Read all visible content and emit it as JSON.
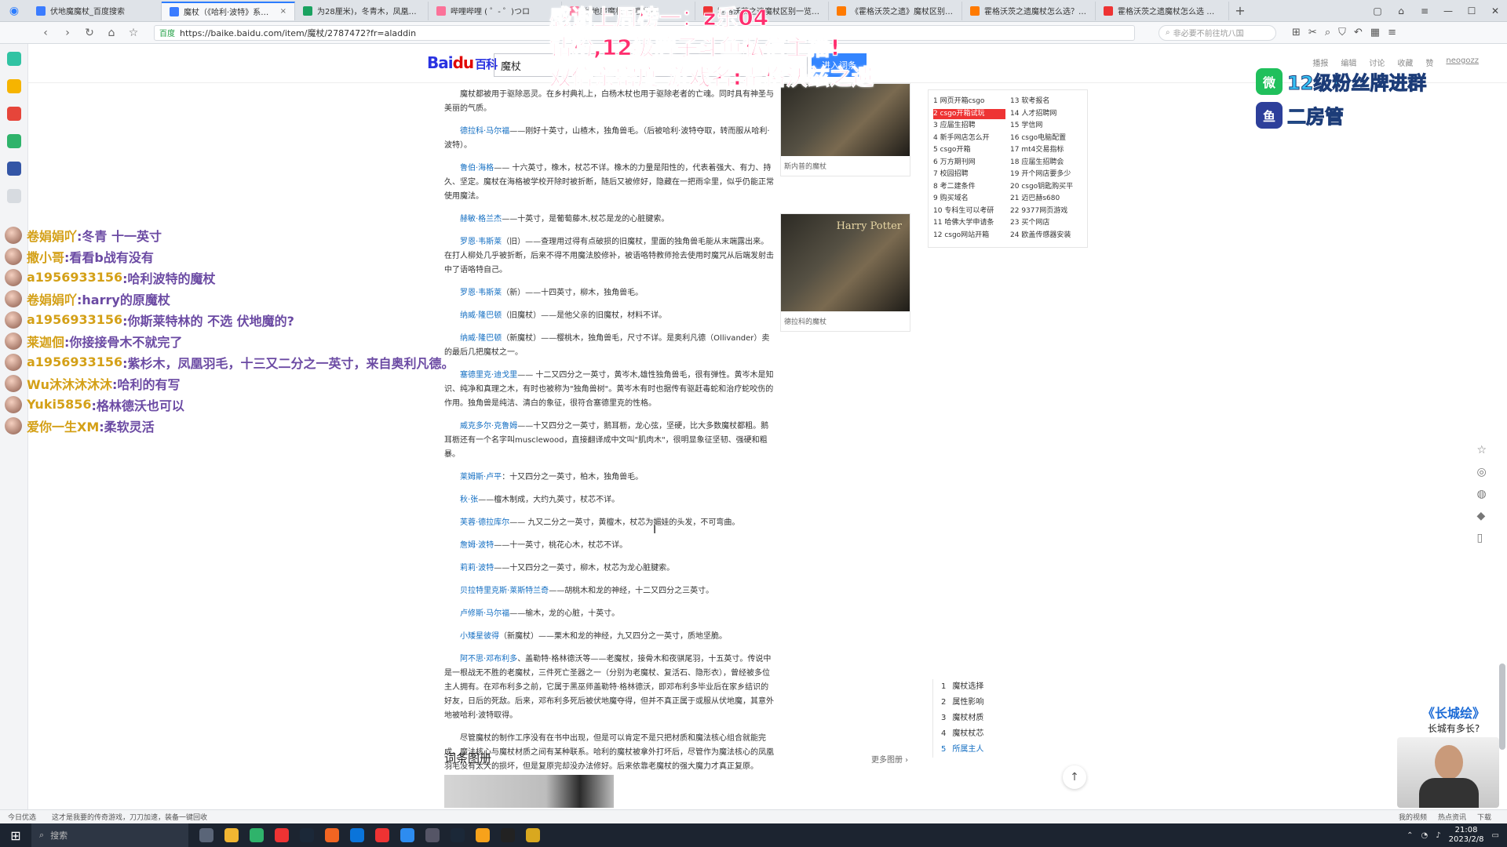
{
  "tabs": [
    {
      "label": "伏地魔魔杖_百度搜索",
      "color": "#3b7cff",
      "active": false
    },
    {
      "label": "魔杖（《哈利·波特》系列中的魔法）",
      "color": "#3b7cff",
      "active": true
    },
    {
      "label": "为28厘米)，冬青木，凤凰羽毛",
      "color": "#1aa260",
      "active": false
    },
    {
      "label": "哔哩哔哩 ( ゜- ゜)つロ",
      "color": "#fb7299",
      "active": false
    },
    {
      "label": "伏地魔魔杖-哔哩哔哩",
      "color": "#fb7299",
      "active": false
    },
    {
      "label": "霍格沃茨之遗魔杖区别一览-JD",
      "color": "#e33",
      "active": false
    },
    {
      "label": "《霍格沃茨之遗》魔杖区别介绍",
      "color": "#ff7a00",
      "active": false
    },
    {
      "label": "霍格沃茨之遗魔杖怎么选？魔杖",
      "color": "#ff7a00",
      "active": false
    },
    {
      "label": "霍格沃茨之遗魔杖怎么选 魔杖",
      "color": "#e33",
      "active": false
    }
  ],
  "address": {
    "secure_label": "百度",
    "url": "https://baike.baidu.com/item/魔杖/2787472?fr=aladdin",
    "side_search_placeholder": "非必要不前往坑八国"
  },
  "header": {
    "logo_bai": "Bai",
    "logo_du": "du",
    "logo_baike": "百科",
    "search_value": "魔杖",
    "enter_button": "进入词条",
    "actions": [
      "播报",
      "编辑",
      "讨论",
      "收藏",
      "赞"
    ],
    "user": "neogozz"
  },
  "overlay_top": {
    "line1": "感谢上周榜一：z乐04",
    "line2": "钻粉,12级牌子斗鱼私信主播!",
    "line3": "双倍亲密度 游戏名:霍格沃兹之遗"
  },
  "wechat_promo": {
    "row1": "12级粉丝牌进群",
    "row2": "二房管",
    "badge1": "微",
    "badge2": "鱼"
  },
  "paragraphs": [
    {
      "name": "",
      "text": "魔杖都被用于驱除恶灵。在乡村典礼上，白杨木杖也用于驱除老者的亡魂。同时具有神圣与美丽的气质。"
    },
    {
      "name": "德拉科·马尔福",
      "text": "——刚好十英寸，山楂木，独角兽毛。（后被哈利·波特夺取，转而服从哈利·波特）。"
    },
    {
      "name": "鲁伯·海格",
      "text": "—— 十六英寸，橡木，杖芯不详。橡木的力量是阳性的，代表着强大、有力、持久、坚定。魔杖在海格被学校开除时被折断，随后又被修好，隐藏在一把雨伞里，似乎仍能正常使用魔法。"
    },
    {
      "name": "赫敏·格兰杰",
      "text": "——十英寸，是葡萄藤木,杖芯是龙的心脏腱索。"
    },
    {
      "name": "罗恩·韦斯莱",
      "text": "（旧）——查理用过得有点破损的旧魔杖，里面的独角兽毛能从末端露出来。在打人柳处几乎被折断，后来不得不用魔法胶修补，被语咯特教师抢去使用时魔咒从后端发射击中了语咯特自己。"
    },
    {
      "name": "罗恩·韦斯莱",
      "text": "（新）——十四英寸，柳木，独角兽毛。"
    },
    {
      "name": "纳威·隆巴顿",
      "text": "（旧魔杖）——是他父亲的旧魔杖，材料不详。"
    },
    {
      "name": "纳威·隆巴顿",
      "text": "（新魔杖）——樱桃木，独角兽毛，尺寸不详。是奥利凡德（Ollivander）卖的最后几把魔杖之一。"
    },
    {
      "name": "塞德里克·迪戈里",
      "text": "—— 十二又四分之一英寸，黄岑木,雄性独角兽毛，很有弹性。黄岑木是知识、纯净和真理之木，有时也被称为\"独角兽树\"。黄岑木有时也据传有驱赶毒蛇和治疗蛇咬伤的作用。独角兽是纯洁、清白的象征，很符合塞德里克的性格。"
    },
    {
      "name": "威克多尔·克鲁姆",
      "text": "——十又四分之一英寸，鹅耳枥，龙心弦，坚硬，比大多数魔杖都粗。鹅耳枥还有一个名字叫musclewood，直接翻译成中文叫\"肌肉木\"，很明显象征坚韧、强硬和粗暴。"
    },
    {
      "name": "莱姆斯·卢平",
      "text": "：十又四分之一英寸，柏木，独角兽毛。"
    },
    {
      "name": "秋·张",
      "text": "——檀木制成，大约九英寸，杖芯不详。"
    },
    {
      "name": "芙蓉·德拉库尔",
      "text": "—— 九又二分之一英寸，黄檀木，杖芯为媚娃的头发，不可弯曲。"
    },
    {
      "name": "詹姆·波特",
      "text": "——十一英寸，桃花心木，杖芯不详。"
    },
    {
      "name": "莉莉·波特",
      "text": "——十又四分之一英寸，柳木，杖芯为龙心脏腱索。"
    },
    {
      "name": "贝拉特里克斯·莱斯特兰奇",
      "text": "——胡桃木和龙的神经，十二又四分之三英寸。"
    },
    {
      "name": "卢修斯·马尔福",
      "text": "——榆木，龙的心脏，十英寸。"
    },
    {
      "name": "小矮星彼得",
      "text": "（新魔杖）——栗木和龙的神经，九又四分之一英寸，质地坚脆。"
    },
    {
      "name": "阿不思·邓布利多",
      "text": "、盖勒特·格林德沃等——老魔杖，接骨木和夜骐尾羽，十五英寸。传说中是一根战无不胜的老魔杖，三件死亡圣器之一（分别为老魔杖、复活石、隐形衣），曾经被多位主人拥有。在邓布利多之前，它属于黑巫师盖勒特·格林德沃，即邓布利多毕业后在家乡结识的好友，日后的死敌。后来，邓布利多死后被伏地魔夺得，但并不真正属于或服从伏地魔，其意外地被哈利·波特取得。"
    },
    {
      "name": "",
      "text": "尽管魔杖的制作工序没有在书中出现，但是可以肯定不是只把材质和魔法核心组合就能完成。魔法核心与魔杖材质之间有某种联系。哈利的魔杖被拿外打坏后，尽管作为魔法核心的凤凰羽毛没有太大的损坏，但是复原完却没办法修好。后来依靠老魔杖的强大魔力才真正复原。"
    }
  ],
  "images": [
    {
      "caption": "斯内普的魔杖"
    },
    {
      "caption": "德拉科的魔杖",
      "brand": "Harry Potter"
    }
  ],
  "hotlist": [
    "1 网页开箱csgo",
    "13 软考报名",
    "2 csgo开箱试玩",
    "14 人才招聘网",
    "3 应届生招聘",
    "15 学信网",
    "4 新手网店怎么开",
    "16 csgo电脑配置",
    "5 csgo开箱",
    "17 mt4交易指标",
    "6 万方期刊网",
    "18 应届生招聘会",
    "7 校园招聘",
    "19 开个网店要多少",
    "8 考二建条件",
    "20 csgo钥匙购买平",
    "9 购买域名",
    "21 迈巴赫s680",
    "10 专科生可以考研",
    "22 9377网页游戏",
    "11 哈佛大学申请条",
    "23 买个网店",
    "12 csgo网站开箱",
    "24 欧盖传感器安装"
  ],
  "toc": [
    {
      "num": "1",
      "label": "魔杖选择"
    },
    {
      "num": "2",
      "label": "属性影响"
    },
    {
      "num": "3",
      "label": "魔杖材质"
    },
    {
      "num": "4",
      "label": "魔杖杖芯"
    },
    {
      "num": "5",
      "label": "所属主人"
    }
  ],
  "album": {
    "title": "词条图册",
    "more": "更多图册 ›"
  },
  "danmaku": [
    {
      "user": "卷娟娟吖",
      "msg": ":冬青 十一英寸"
    },
    {
      "user": "撒小哥",
      "msg": ":看看b战有没有"
    },
    {
      "user": "a1956933156",
      "msg": ":哈利波特的魔杖"
    },
    {
      "user": "卷娟娟吖",
      "msg": ":harry的原魔杖"
    },
    {
      "user": "a1956933156",
      "msg": ":你斯莱特林的 不选 伏地魔的?"
    },
    {
      "user": "莱迦佪",
      "msg": ":你接接骨木不就完了"
    },
    {
      "user": "a1956933156",
      "msg": ":紫杉木，凤凰羽毛，十三又二分之一英寸，来自奥利凡德。"
    },
    {
      "user": "Wu沐沐沐沐沐",
      "msg": ":哈利的有写"
    },
    {
      "user": "Yuki5856",
      "msg": ":格林德沃也可以"
    },
    {
      "user": "爱你一生XM",
      "msg": ":柔软灵活"
    }
  ],
  "great_wall": {
    "title": "《长城绘》",
    "subtitle": "长城有多长?"
  },
  "statusbar": {
    "left1": "今日优选",
    "left2": "这才是我要的传奇游戏，刀刀加速，装备一键回收",
    "right": [
      "我的视频",
      "热点资讯",
      "下载"
    ]
  },
  "taskbar": {
    "search_placeholder": "搜索",
    "time": "21:08",
    "date": "2023/2/8"
  }
}
